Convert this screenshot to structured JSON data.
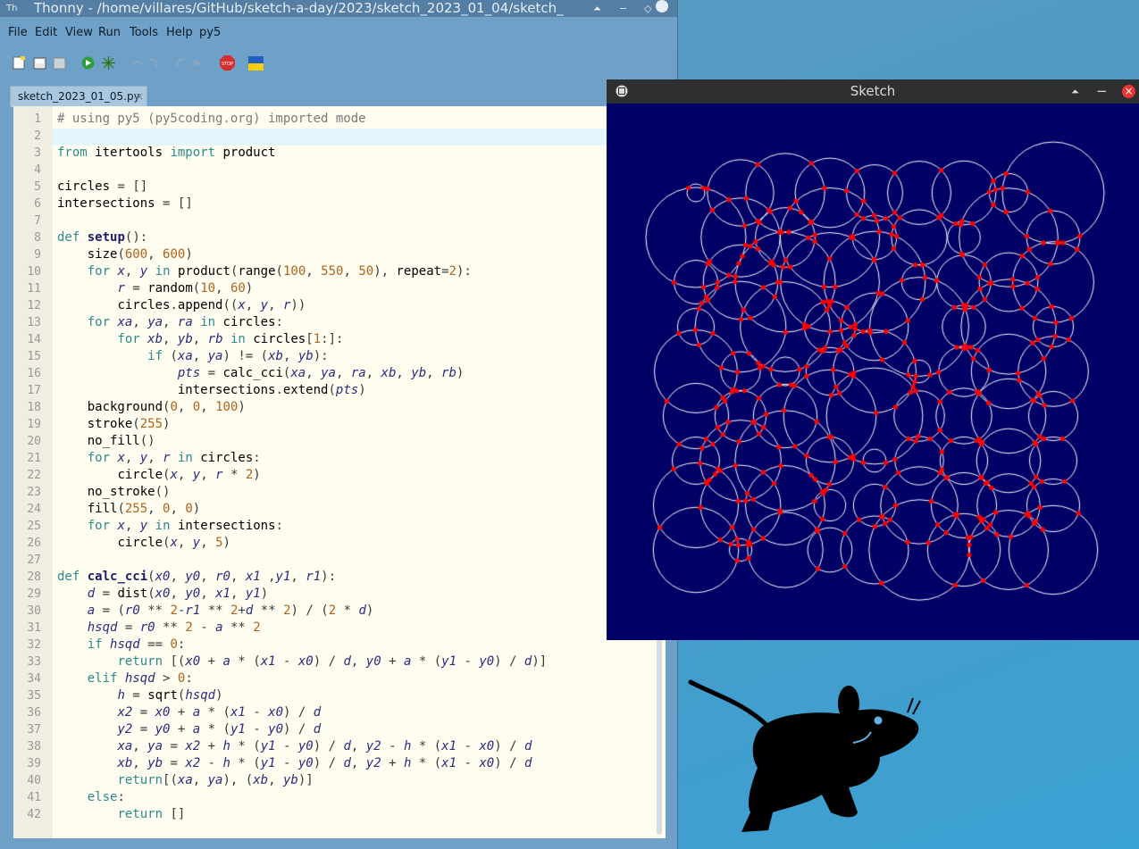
{
  "thonny": {
    "title": "Thonny  -  /home/villares/GitHub/sketch-a-day/2023/sketch_2023_01_04/sketch_",
    "app_icon": "Th",
    "menus": [
      "File",
      "Edit",
      "View",
      "Run",
      "Tools",
      "Help",
      "py5"
    ],
    "tab": {
      "label": "sketch_2023_01_05.py",
      "close": "×"
    },
    "toolbar_icons": [
      "new-file-icon",
      "open-file-icon",
      "save-icon",
      "run-icon",
      "debug-icon",
      "step-over-icon",
      "step-into-icon",
      "step-out-icon",
      "resume-icon",
      "stop-icon",
      "ukraine-flag-icon"
    ],
    "stop_label": "STOP"
  },
  "code_lines": [
    "# using py5 (py5coding.org) imported mode",
    "",
    "from itertools import product",
    "",
    "circles = []",
    "intersections = []",
    "",
    "def setup():",
    "    size(600, 600)",
    "    for x, y in product(range(100, 550, 50), repeat=2):",
    "        r = random(10, 60)",
    "        circles.append((x, y, r))",
    "    for xa, ya, ra in circles:",
    "        for xb, yb, rb in circles[1:]:",
    "            if (xa, ya) != (xb, yb):",
    "                pts = calc_cci(xa, ya, ra, xb, yb, rb)",
    "                intersections.extend(pts)",
    "    background(0, 0, 100)",
    "    stroke(255)",
    "    no_fill()",
    "    for x, y, r in circles:",
    "        circle(x, y, r * 2)",
    "    no_stroke()",
    "    fill(255, 0, 0)",
    "    for x, y in intersections:",
    "        circle(x, y, 5)",
    "",
    "def calc_cci(x0, y0, r0, x1 ,y1, r1):",
    "    d = dist(x0, y0, x1, y1)",
    "    a = (r0 ** 2-r1 ** 2+d ** 2) / (2 * d)",
    "    hsqd = r0 ** 2 - a ** 2",
    "    if hsqd == 0:",
    "        return [(x0 + a * (x1 - x0) / d, y0 + a * (y1 - y0) / d)]",
    "    elif hsqd > 0:",
    "        h = sqrt(hsqd)",
    "        x2 = x0 + a * (x1 - x0) / d",
    "        y2 = y0 + a * (y1 - y0) / d",
    "        xa, ya = x2 + h * (y1 - y0) / d, y2 - h * (x1 - x0) / d",
    "        xb, yb = x2 - h * (y1 - y0) / d, y2 + h * (x1 - x0) / d",
    "        return[(xa, ya), (xb, yb)]",
    "    else:",
    "        return []"
  ],
  "sketch": {
    "title": "Sketch",
    "background": "#000066",
    "stroke": "#ffffff",
    "dot": "#ff0000"
  },
  "colors": {
    "thonny_bg": "#6fa1c8",
    "editor_bg": "#fffdef",
    "desktop": "#4d9ac6"
  }
}
